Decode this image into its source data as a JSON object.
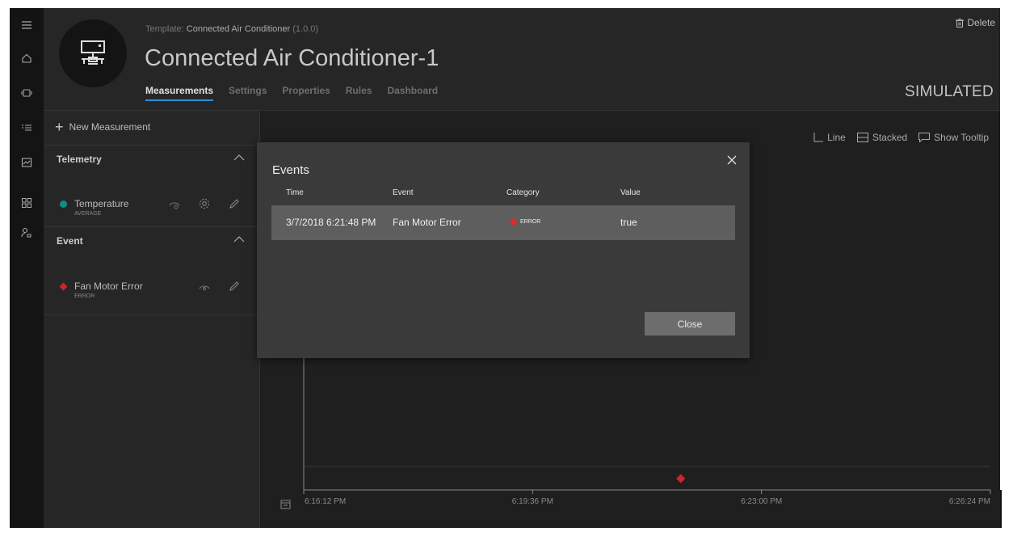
{
  "header": {
    "template_prefix": "Template:",
    "template_name": "Connected Air Conditioner",
    "template_version": "(1.0.0)",
    "device_title": "Connected Air Conditioner-1",
    "tabs": [
      {
        "label": "Measurements",
        "active": true
      },
      {
        "label": "Settings",
        "active": false
      },
      {
        "label": "Properties",
        "active": false
      },
      {
        "label": "Rules",
        "active": false
      },
      {
        "label": "Dashboard",
        "active": false
      }
    ],
    "delete_label": "Delete",
    "status": "SIMULATED"
  },
  "rail": {
    "icons": [
      "menu-icon",
      "home-icon",
      "device-icon",
      "list-icon",
      "analytics-icon",
      "dashboard-icon",
      "admin-icon"
    ]
  },
  "measurements_panel": {
    "new_measurement_label": "New Measurement",
    "sections": [
      {
        "label": "Telemetry",
        "items": [
          {
            "name": "Temperature",
            "sub": "AVERAGE",
            "color": "#0e8f7d"
          }
        ]
      },
      {
        "label": "Event",
        "items": [
          {
            "name": "Fan Motor Error",
            "sub": "ERROR",
            "color": "#c8272d"
          }
        ]
      }
    ]
  },
  "chart_toolbar": {
    "line_label": "Line",
    "stacked_label": "Stacked",
    "tooltip_label": "Show Tooltip"
  },
  "chart_data": {
    "type": "scatter",
    "x_tick_labels": [
      "6:16:12 PM",
      "6:19:36 PM",
      "6:23:00 PM",
      "6:26:24 PM"
    ],
    "series": [
      {
        "name": "Fan Motor Error",
        "color": "#c8272d",
        "points": [
          {
            "x": "6:21:48 PM"
          }
        ]
      }
    ]
  },
  "modal": {
    "title": "Events",
    "columns": [
      "Time",
      "Event",
      "Category",
      "Value"
    ],
    "rows": [
      {
        "time": "3/7/2018 6:21:48 PM",
        "event": "Fan Motor Error",
        "category": "ERROR",
        "value": "true"
      }
    ],
    "close_label": "Close"
  },
  "colors": {
    "accent": "#2b8fd6",
    "telemetry": "#0e8f7d",
    "error": "#c8272d"
  }
}
